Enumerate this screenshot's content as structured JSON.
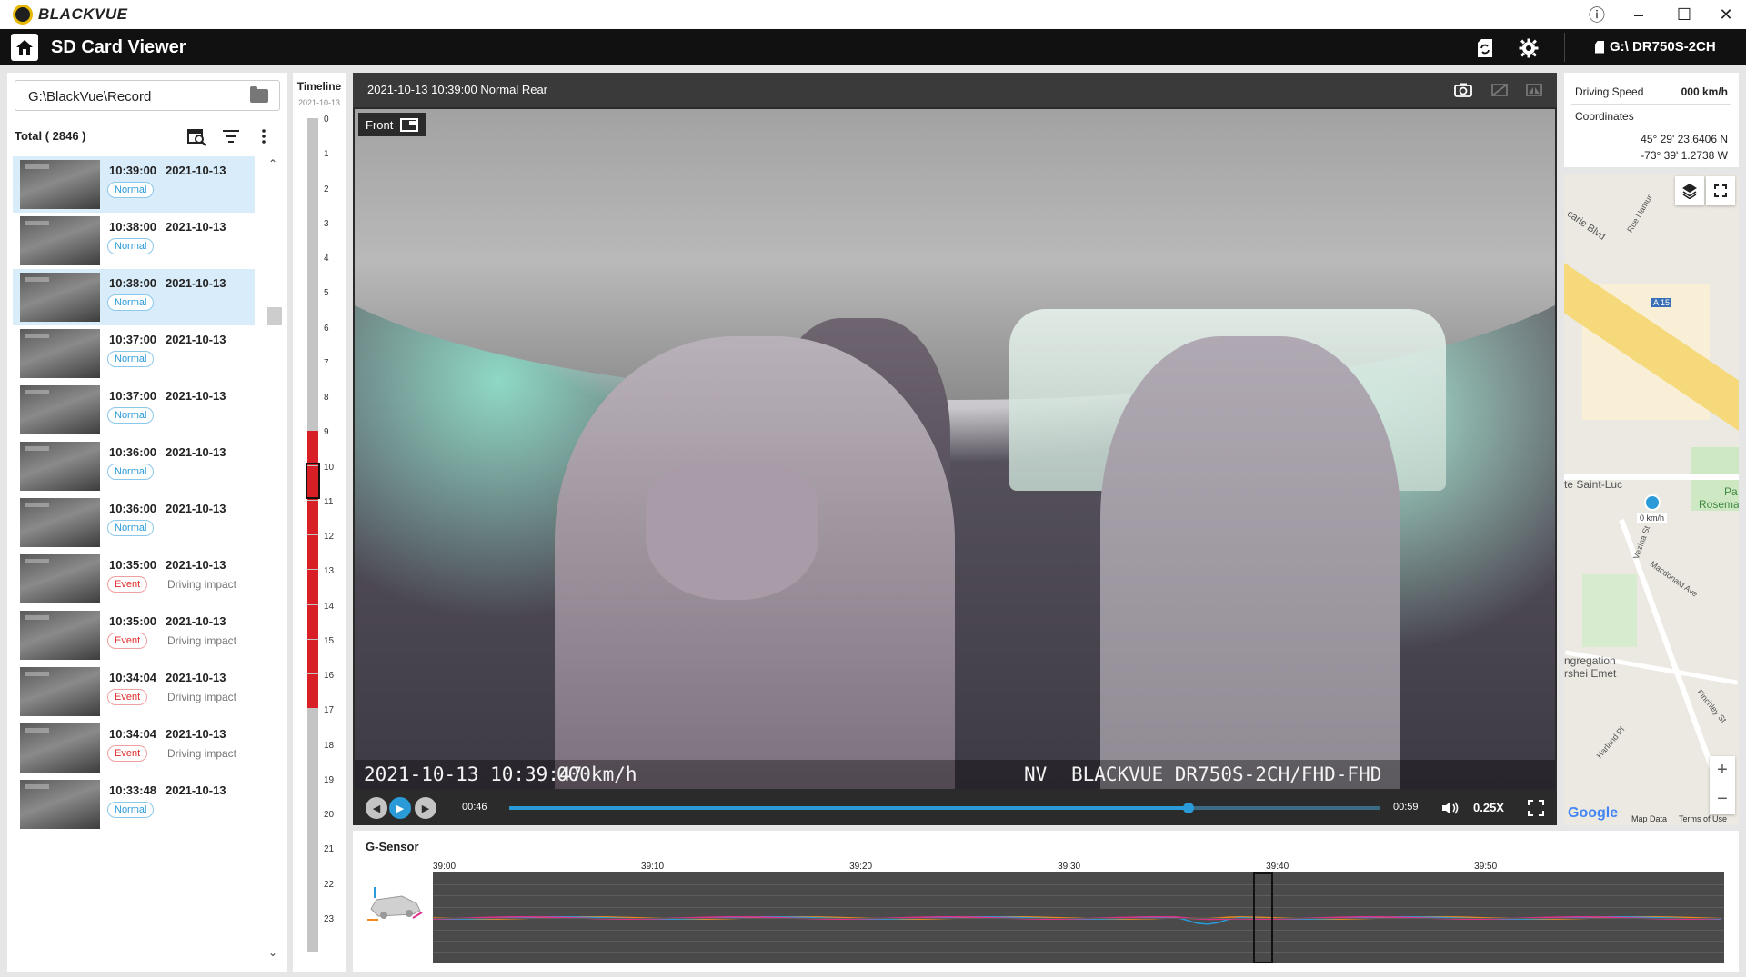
{
  "app": {
    "logo_text": "BLACKVUE",
    "title": "SD Card Viewer",
    "device": "G:\\ DR750S-2CH"
  },
  "window_controls": {
    "info": "ⓘ",
    "minimize": "–",
    "maximize": "☐",
    "close": "✕"
  },
  "sidebar": {
    "path": "G:\\BlackVue\\Record",
    "total": "Total ( 2846 )",
    "files": [
      {
        "time": "10:39:00",
        "date": "2021-10-13",
        "type": "Normal",
        "sub": "",
        "selected": true
      },
      {
        "time": "10:38:00",
        "date": "2021-10-13",
        "type": "Normal",
        "sub": "",
        "selected": false
      },
      {
        "time": "10:38:00",
        "date": "2021-10-13",
        "type": "Normal",
        "sub": "",
        "selected": true
      },
      {
        "time": "10:37:00",
        "date": "2021-10-13",
        "type": "Normal",
        "sub": "",
        "selected": false
      },
      {
        "time": "10:37:00",
        "date": "2021-10-13",
        "type": "Normal",
        "sub": "",
        "selected": false
      },
      {
        "time": "10:36:00",
        "date": "2021-10-13",
        "type": "Normal",
        "sub": "",
        "selected": false
      },
      {
        "time": "10:36:00",
        "date": "2021-10-13",
        "type": "Normal",
        "sub": "",
        "selected": false
      },
      {
        "time": "10:35:00",
        "date": "2021-10-13",
        "type": "Event",
        "sub": "Driving impact",
        "selected": false
      },
      {
        "time": "10:35:00",
        "date": "2021-10-13",
        "type": "Event",
        "sub": "Driving impact",
        "selected": false
      },
      {
        "time": "10:34:04",
        "date": "2021-10-13",
        "type": "Event",
        "sub": "Driving impact",
        "selected": false
      },
      {
        "time": "10:34:04",
        "date": "2021-10-13",
        "type": "Event",
        "sub": "Driving impact",
        "selected": false
      },
      {
        "time": "10:33:48",
        "date": "2021-10-13",
        "type": "Normal",
        "sub": "",
        "selected": false
      }
    ]
  },
  "timeline": {
    "title": "Timeline",
    "date": "2021-10-13",
    "hours": [
      "0",
      "1",
      "2",
      "3",
      "4",
      "5",
      "6",
      "7",
      "8",
      "9",
      "10",
      "11",
      "12",
      "13",
      "14",
      "15",
      "16",
      "17",
      "18",
      "19",
      "20",
      "21",
      "22",
      "23"
    ],
    "recorded_hours": [
      9,
      10,
      11,
      12,
      13,
      14,
      15,
      16
    ],
    "current_hour": 10
  },
  "video": {
    "title": "2021-10-13 10:39:00 Normal Rear",
    "camera_label": "Front",
    "osd_datetime": "2021-10-13 10:39:47",
    "osd_speed": "000km/h",
    "osd_mode": "NV",
    "osd_model": "BLACKVUE DR750S-2CH/FHD-FHD",
    "current_time": "00:46",
    "duration": "00:59",
    "progress_fraction": 0.78,
    "speed": "0.25X"
  },
  "info": {
    "driving_speed_label": "Driving Speed",
    "driving_speed_value": "000 km/h",
    "coordinates_label": "Coordinates",
    "lat": "45° 29' 23.6406 N",
    "lon": "-73° 39' 1.2738 W"
  },
  "map": {
    "labels": {
      "carie": "carie Blvd",
      "namur": "Rue Namur",
      "a15": "A 15",
      "saint_luc": "te Saint-Luc",
      "p": "Pa",
      "rosema": "Rosema",
      "speed": "0 km/h",
      "macdonald": "Macdonald Ave",
      "congregation": "ngregation",
      "shei": "rshei Emet",
      "finchley": "Finchley St",
      "harland": "Harland Pl",
      "vezina": "Vezina St"
    },
    "google": "Google",
    "map_data": "Map Data",
    "terms": "Terms of Use"
  },
  "gsensor": {
    "title": "G-Sensor",
    "ticks": [
      "39:00",
      "39:10",
      "39:20",
      "39:30",
      "39:40",
      "39:50"
    ],
    "cursor_fraction": 0.635
  },
  "colors": {
    "accent": "#2a9bd8",
    "event": "#e02a2a",
    "timeline_recorded": "#d91f26"
  }
}
